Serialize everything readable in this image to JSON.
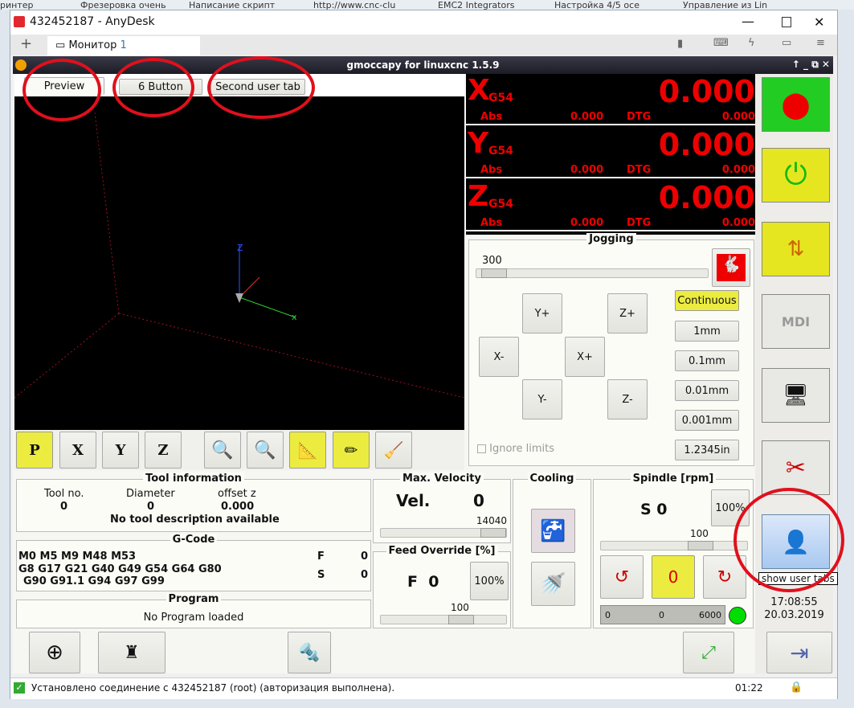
{
  "browser_bookmarks": [
    "ринтер",
    "Фрезеровка очень",
    "Написание скрипт",
    "http://www.cnc-clu",
    "EMC2 Integrators",
    "Настройка 4/5 осе",
    "Управление из Lin"
  ],
  "anydesk": {
    "title": "432452187 - AnyDesk",
    "tab": "Монитор",
    "tab_num": "1",
    "status": "Установлено соединение с 432452187 (root) (авторизация выполнена).",
    "time": "01:22",
    "accent": "#e2282e"
  },
  "gmoccapy": {
    "title": "gmoccapy for linuxcnc  1.5.9",
    "tabs": [
      "Preview",
      "6 Button",
      "Second user tab"
    ],
    "dro": [
      {
        "axis": "X",
        "offset": "G54",
        "value": "0.000",
        "abs_label": "Abs",
        "abs": "0.000",
        "dtg_label": "DTG",
        "dtg": "0.000"
      },
      {
        "axis": "Y",
        "offset": "G54",
        "value": "0.000",
        "abs_label": "Abs",
        "abs": "0.000",
        "dtg_label": "DTG",
        "dtg": "0.000"
      },
      {
        "axis": "Z",
        "offset": "G54",
        "value": "0.000",
        "abs_label": "Abs",
        "abs": "0.000",
        "dtg_label": "DTG",
        "dtg": "0.000"
      }
    ],
    "jogging": {
      "title": "Jogging",
      "speed": "300",
      "buttons": [
        "Y+",
        "Z+",
        "X-",
        "X+",
        "Y-",
        "Z-"
      ],
      "increments": [
        "Continuous",
        "1mm",
        "0.1mm",
        "0.01mm",
        "0.001mm",
        "1.2345in"
      ],
      "ignore_limits": "Ignore limits"
    },
    "toolbar": [
      "P",
      "X",
      "Y",
      "Z"
    ],
    "tool": {
      "title": "Tool information",
      "headers": [
        "Tool no.",
        "Diameter",
        "offset z"
      ],
      "values": [
        "0",
        "0",
        "0.000"
      ],
      "description": "No tool description available"
    },
    "gcode": {
      "title": "G-Code",
      "lines": [
        "M0 M5 M9 M48 M53",
        "G8 G17 G21 G40 G49 G54 G64 G80",
        "G90 G91.1 G94 G97 G99"
      ],
      "f_label": "F",
      "f": "0",
      "s_label": "S",
      "s": "0"
    },
    "program": {
      "title": "Program",
      "text": "No Program loaded"
    },
    "velocity": {
      "title": "Max. Velocity",
      "label": "Vel.",
      "value": "0",
      "max": "14040"
    },
    "feed": {
      "title": "Feed Override [%]",
      "label": "F  0",
      "reset": "100%",
      "value": "100"
    },
    "cooling": {
      "title": "Cooling"
    },
    "spindle": {
      "title": "Spindle [rpm]",
      "label": "S 0",
      "reset": "100%",
      "value": "100",
      "bar_min": "0",
      "bar_val": "0",
      "bar_max": "6000"
    },
    "tooltip": "show user tabs",
    "clock": {
      "time": "17:08:55",
      "date": "20.03.2019"
    }
  }
}
